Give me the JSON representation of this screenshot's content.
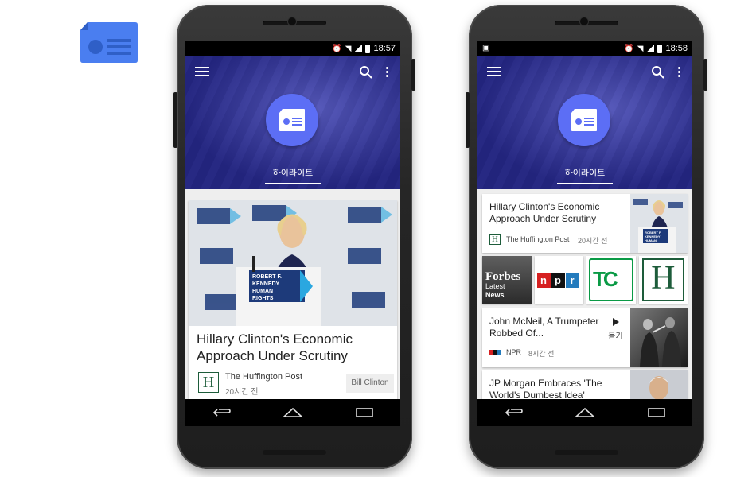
{
  "phone1": {
    "status_time": "18:57",
    "header": {
      "section_title": "하이라이트"
    },
    "hero": {
      "photo_sign_text": "ROBERT F. KENNEDY HUMAN RIGHTS",
      "title": "Hillary Clinton's Economic Approach Under Scrutiny",
      "source": "The Huffington Post",
      "source_logo_letter": "H",
      "time": "20시간 전",
      "tag": "Bill Clinton"
    }
  },
  "phone2": {
    "status_time": "18:58",
    "header": {
      "section_title": "하이라이트"
    },
    "card1": {
      "title": "Hillary Clinton's Economic Approach Under Scrutiny",
      "source": "The Huffington Post",
      "source_logo_letter": "H",
      "time": "20시간 전"
    },
    "sources": {
      "forbes": {
        "line1": "Forbes",
        "line2": "Latest",
        "line3": "News"
      },
      "npr": [
        "n",
        "p",
        "r"
      ],
      "tc": "TC",
      "huffpost": "H"
    },
    "card2": {
      "title": "John McNeil, A Trumpeter Robbed Of...",
      "source": "NPR",
      "time": "8시간 전",
      "listen_label": "듣기"
    },
    "card3": {
      "title": "JP Morgan Embraces 'The World's Dumbest Idea'"
    }
  },
  "colors": {
    "header_blue": "#3c3fb0",
    "badge_blue": "#5c6ef5",
    "app_logo_blue": "#4a7ef0",
    "tc_green": "#0a9a45",
    "huffpost_green": "#1d5c3a"
  }
}
